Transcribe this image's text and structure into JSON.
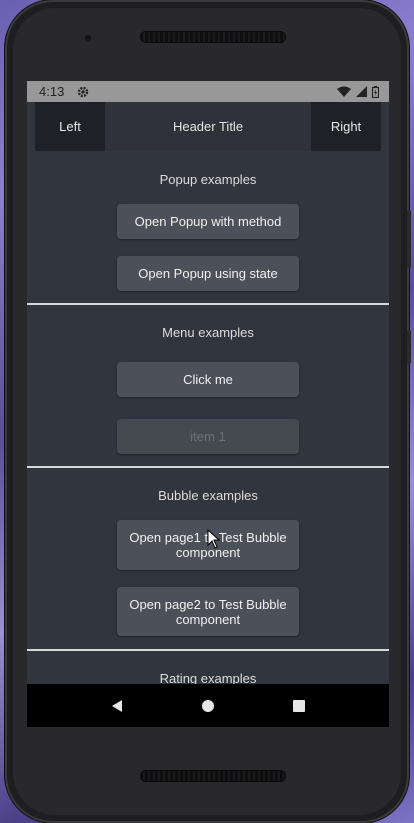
{
  "statusbar": {
    "time": "4:13",
    "icons": [
      "gear-icon",
      "wifi-icon",
      "signal-icon",
      "battery-icon"
    ]
  },
  "header": {
    "left_label": "Left",
    "title": "Header Title",
    "right_label": "Right"
  },
  "sections": {
    "popup": {
      "title": "Popup examples",
      "button_method": "Open Popup with method",
      "button_state": "Open Popup using state"
    },
    "menu": {
      "title": "Menu examples",
      "button_click": "Click me",
      "item_1": "item 1"
    },
    "bubble": {
      "title": "Bubble examples",
      "button_page1": "Open page1 to Test Bubble component",
      "button_page2": "Open page2 to Test Bubble component"
    },
    "rating": {
      "title": "Rating examples"
    }
  },
  "navbar": {
    "icons": [
      "back-icon",
      "home-icon",
      "recents-icon"
    ]
  },
  "colors": {
    "screen_bg": "#31353e",
    "button_bg": "#4c5058",
    "header_button_bg": "#1f2127",
    "statusbar_bg": "#989898",
    "divider": "#d6d8dc"
  }
}
